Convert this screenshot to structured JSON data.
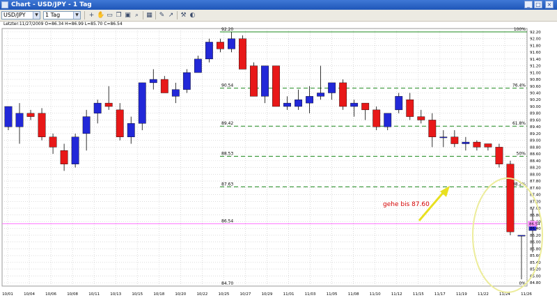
{
  "window": {
    "title": "Chart - USD/JPY - 1 Tag",
    "min_glyph": "_",
    "max_glyph": "□",
    "close_glyph": "×"
  },
  "toolbar": {
    "symbol": "USD/JPY",
    "timeframe": "1 Tag",
    "dropdown_glyph": "▼",
    "buttons": [
      {
        "name": "crosshair-icon",
        "glyph": "+"
      },
      {
        "name": "hand-icon",
        "glyph": "✋"
      },
      {
        "name": "print-icon",
        "glyph": "▭"
      },
      {
        "name": "copy-icon",
        "glyph": "❐"
      },
      {
        "name": "save-icon",
        "glyph": "▣"
      },
      {
        "name": "zoom-icon",
        "glyph": "⌕"
      },
      {
        "name": "grid-icon",
        "glyph": "▦"
      },
      {
        "name": "drawing-tools-icon",
        "glyph": "✎"
      },
      {
        "name": "line-tool-icon",
        "glyph": "↗"
      },
      {
        "name": "indicator-icon",
        "glyph": "⚒"
      },
      {
        "name": "properties-icon",
        "glyph": "◐"
      }
    ]
  },
  "infobar": {
    "text": "Letzter:11/27/2009 O=86.34 H=86.99 L=85.70 C=86.54"
  },
  "colors": {
    "up": "#2228d8",
    "down": "#e81818",
    "wick": "#000000",
    "grid": "#c6c6c6",
    "fib": "#1e8a1e",
    "current_line": "#ff66ff",
    "current_badge": "#ff99ff",
    "annotation_text": "#d40000",
    "arrow": "#e8e020",
    "ellipse": "#ecec9a"
  },
  "chart_data": {
    "type": "candlestick",
    "ylim": [
      84.7,
      92.3
    ],
    "y_ticks": [
      84.8,
      85.0,
      85.2,
      85.4,
      85.6,
      85.8,
      86.0,
      86.2,
      86.4,
      86.6,
      86.8,
      87.0,
      87.2,
      87.4,
      87.6,
      87.8,
      88.0,
      88.2,
      88.4,
      88.6,
      88.8,
      89.0,
      89.2,
      89.4,
      89.6,
      89.8,
      90.0,
      90.2,
      90.4,
      90.6,
      90.8,
      91.0,
      91.2,
      91.4,
      91.6,
      91.8,
      92.0,
      92.2
    ],
    "x_tick_labels": [
      "10/01",
      "10/04",
      "10/06",
      "10/08",
      "10/11",
      "10/13",
      "10/15",
      "10/18",
      "10/20",
      "10/22",
      "10/25",
      "10/27",
      "10/29",
      "11/01",
      "11/03",
      "11/05",
      "11/08",
      "11/10",
      "11/12",
      "11/15",
      "11/17",
      "11/19",
      "11/22",
      "11/24",
      "11/26"
    ],
    "candles": [
      {
        "o": 89.4,
        "h": 90.0,
        "l": 89.3,
        "c": 90.0
      },
      {
        "o": 89.4,
        "h": 90.1,
        "l": 88.9,
        "c": 89.8
      },
      {
        "o": 89.8,
        "h": 89.9,
        "l": 89.6,
        "c": 89.7
      },
      {
        "o": 89.8,
        "h": 89.95,
        "l": 89.0,
        "c": 89.1
      },
      {
        "o": 89.1,
        "h": 89.2,
        "l": 88.6,
        "c": 88.8
      },
      {
        "o": 88.7,
        "h": 88.9,
        "l": 88.1,
        "c": 88.3
      },
      {
        "o": 88.3,
        "h": 89.2,
        "l": 88.2,
        "c": 89.1
      },
      {
        "o": 89.2,
        "h": 89.9,
        "l": 88.7,
        "c": 89.7
      },
      {
        "o": 89.8,
        "h": 90.2,
        "l": 89.5,
        "c": 90.1
      },
      {
        "o": 90.1,
        "h": 90.6,
        "l": 89.9,
        "c": 90.0
      },
      {
        "o": 89.9,
        "h": 90.1,
        "l": 89.0,
        "c": 89.1
      },
      {
        "o": 89.1,
        "h": 89.7,
        "l": 88.9,
        "c": 89.5
      },
      {
        "o": 89.5,
        "h": 90.7,
        "l": 89.3,
        "c": 90.7
      },
      {
        "o": 90.7,
        "h": 91.1,
        "l": 90.5,
        "c": 90.8
      },
      {
        "o": 90.8,
        "h": 90.9,
        "l": 90.4,
        "c": 90.4
      },
      {
        "o": 90.3,
        "h": 90.7,
        "l": 90.1,
        "c": 90.5
      },
      {
        "o": 90.5,
        "h": 91.1,
        "l": 90.4,
        "c": 91.0
      },
      {
        "o": 91.0,
        "h": 91.5,
        "l": 91.0,
        "c": 91.4
      },
      {
        "o": 91.4,
        "h": 92.0,
        "l": 91.3,
        "c": 91.9
      },
      {
        "o": 91.9,
        "h": 92.0,
        "l": 91.6,
        "c": 91.7
      },
      {
        "o": 91.7,
        "h": 92.2,
        "l": 91.6,
        "c": 92.0
      },
      {
        "o": 92.0,
        "h": 92.1,
        "l": 91.1,
        "c": 91.1
      },
      {
        "o": 91.2,
        "h": 91.3,
        "l": 90.3,
        "c": 90.3
      },
      {
        "o": 90.3,
        "h": 91.2,
        "l": 90.1,
        "c": 91.2
      },
      {
        "o": 91.2,
        "h": 91.2,
        "l": 90.0,
        "c": 90.0
      },
      {
        "o": 90.0,
        "h": 90.3,
        "l": 89.9,
        "c": 90.1
      },
      {
        "o": 90.0,
        "h": 90.5,
        "l": 89.9,
        "c": 90.2
      },
      {
        "o": 90.1,
        "h": 90.6,
        "l": 89.8,
        "c": 90.3
      },
      {
        "o": 90.3,
        "h": 91.2,
        "l": 90.2,
        "c": 90.4
      },
      {
        "o": 90.4,
        "h": 90.7,
        "l": 90.2,
        "c": 90.7
      },
      {
        "o": 90.7,
        "h": 90.8,
        "l": 89.9,
        "c": 90.0
      },
      {
        "o": 90.0,
        "h": 90.2,
        "l": 89.7,
        "c": 90.1
      },
      {
        "o": 90.1,
        "h": 90.1,
        "l": 89.6,
        "c": 89.9
      },
      {
        "o": 89.9,
        "h": 90.0,
        "l": 89.3,
        "c": 89.4
      },
      {
        "o": 89.4,
        "h": 89.8,
        "l": 89.3,
        "c": 89.8
      },
      {
        "o": 89.9,
        "h": 90.4,
        "l": 89.8,
        "c": 90.3
      },
      {
        "o": 90.2,
        "h": 90.4,
        "l": 89.6,
        "c": 89.7
      },
      {
        "o": 89.7,
        "h": 89.9,
        "l": 89.5,
        "c": 89.6
      },
      {
        "o": 89.6,
        "h": 89.8,
        "l": 88.8,
        "c": 89.1
      },
      {
        "o": 89.1,
        "h": 89.3,
        "l": 88.8,
        "c": 89.1
      },
      {
        "o": 89.1,
        "h": 89.3,
        "l": 88.8,
        "c": 88.9
      },
      {
        "o": 88.9,
        "h": 89.1,
        "l": 88.7,
        "c": 88.95
      },
      {
        "o": 88.95,
        "h": 89.0,
        "l": 88.7,
        "c": 88.8
      },
      {
        "o": 88.9,
        "h": 88.9,
        "l": 88.7,
        "c": 88.8
      },
      {
        "o": 88.8,
        "h": 88.9,
        "l": 88.2,
        "c": 88.3
      },
      {
        "o": 88.3,
        "h": 88.4,
        "l": 86.2,
        "c": 86.3
      },
      {
        "o": 86.2,
        "h": 86.2,
        "l": 84.9,
        "c": 86.2
      },
      {
        "o": 86.34,
        "h": 86.99,
        "l": 85.7,
        "c": 86.54
      }
    ],
    "fib_levels": [
      {
        "label_left": "92.20",
        "label_right": "100%",
        "value": 92.2
      },
      {
        "label_left": "90.54",
        "label_right": "76.4%",
        "value": 90.54
      },
      {
        "label_left": "89.42",
        "label_right": "61.8%",
        "value": 89.42
      },
      {
        "label_left": "88.53",
        "label_right": "50%",
        "value": 88.53
      },
      {
        "label_left": "87.63",
        "label_right": "38.2%",
        "value": 87.63
      },
      {
        "label_left": "86.54",
        "label_right": "",
        "value": 86.54
      },
      {
        "label_left": "84.70",
        "label_right": "0%",
        "value": 84.7
      }
    ],
    "current_price": {
      "value": 86.54,
      "label": "86.54"
    },
    "annotation": {
      "text": "gehe bis 87.60"
    }
  }
}
